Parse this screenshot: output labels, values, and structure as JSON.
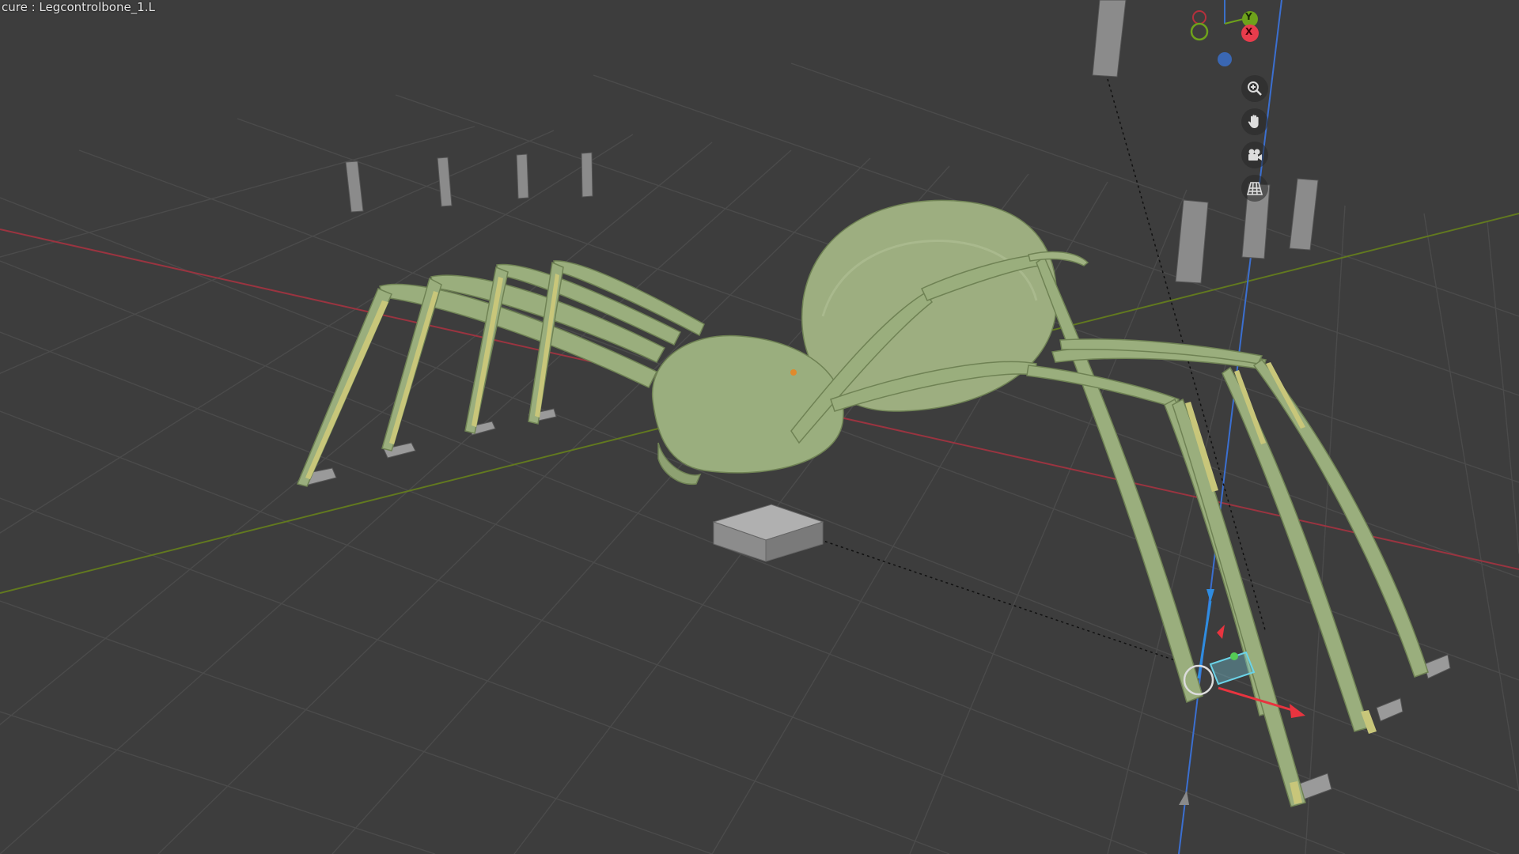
{
  "viewport": {
    "header_text": "cure : Legcontrolbone_1.L",
    "background": "#3d3d3d"
  },
  "gizmo": {
    "axes": [
      {
        "label": "Y",
        "color": "#6ea21b"
      },
      {
        "label": "X",
        "color": "#e83c4c"
      },
      {
        "label": "Z",
        "color": "#3a6fc8"
      }
    ]
  },
  "navigation": {
    "buttons": [
      {
        "name": "zoom-icon"
      },
      {
        "name": "pan-hand-icon"
      },
      {
        "name": "camera-icon"
      },
      {
        "name": "perspective-grid-icon"
      }
    ]
  },
  "colors": {
    "mesh": "#9db07f",
    "mesh_dark": "#7d9060",
    "bone_highlight": "#c9c97a",
    "grid_line": "#4a4a4a",
    "axis_x": "#b03a48",
    "axis_y": "#6e8a2a",
    "axis_z": "#3b6fd0",
    "control_bone": "#8a8a8a"
  }
}
